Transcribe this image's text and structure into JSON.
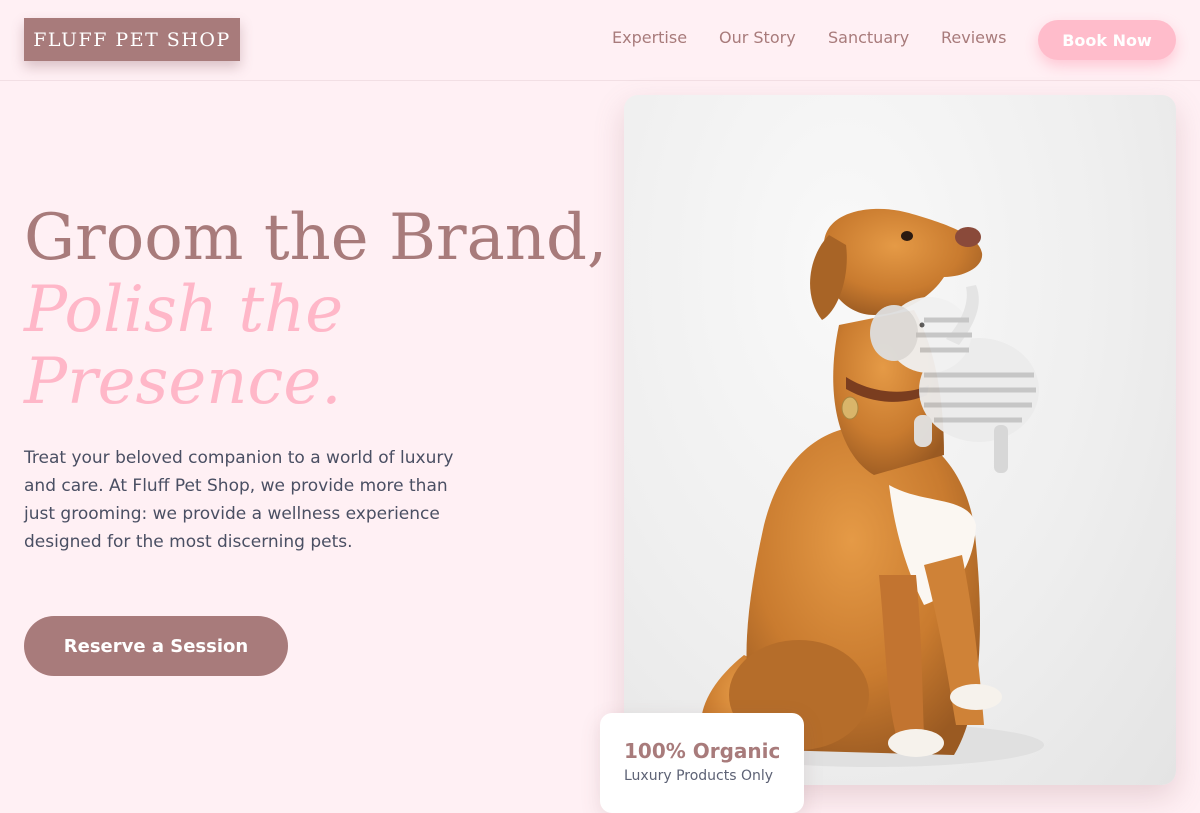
{
  "brand": {
    "logo_text": "FLUFF PET SHOP"
  },
  "nav": {
    "items": [
      {
        "label": "Expertise"
      },
      {
        "label": "Our Story"
      },
      {
        "label": "Sanctuary"
      },
      {
        "label": "Reviews"
      }
    ],
    "book_label": "Book Now"
  },
  "hero": {
    "title_line1": "Groom the Brand,",
    "title_line2": "Polish the",
    "title_line3": "Presence.",
    "description": "Treat your beloved companion to a world of luxury and care. At Fluff Pet Shop, we provide more than just grooming: we provide a wellness experience designed for the most discerning pets.",
    "cta_label": "Reserve a Session"
  },
  "badge": {
    "title": "100% Organic",
    "subtitle": "Luxury Products Only"
  },
  "colors": {
    "background": "#fff0f4",
    "brand_mauve": "#a87b7b",
    "accent_pink": "#ffb7c8",
    "body_text": "#4a4f63"
  },
  "image": {
    "subject": "golden-retriever-with-plush-elephant-toy"
  }
}
